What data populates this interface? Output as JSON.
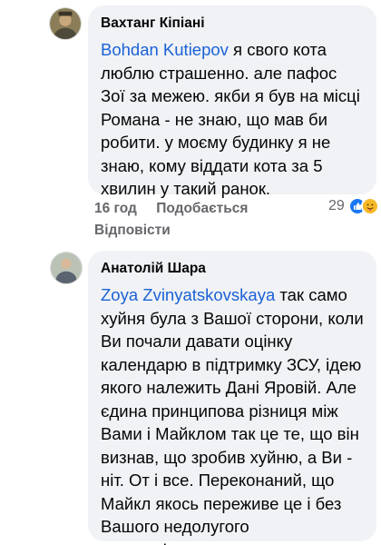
{
  "comments": [
    {
      "author": "Вахтанг Кіпіані",
      "mention": "Bohdan Kutiepov",
      "text": " я свого кота люблю страшенно. але пафос Зої за межею. якби я був на місці Романа - не знаю, що мав би робити. у моєму будинку я не знаю, кому віддати кота за 5 хвилин у такий ранок.",
      "time": "16 год",
      "like_label": "Подобається",
      "reply_label": "Відповісти",
      "reaction_count": "29",
      "reaction_icons": [
        "like-icon",
        "care-icon"
      ],
      "colors": {
        "like": "#1877f2",
        "care": "#f7b928"
      }
    },
    {
      "author": "Анатолій Шара",
      "mention": "Zoya Zvinyatskovskaya",
      "text": " так само хуйня була з Вашої сторони, коли Ви почали давати оцінку календарю в підтримку ЗСУ, ідею якого належить Дані Яровій. Але єдина принципова різниця між Вами і Майклом так це те, що він визнав, що зробив хуйню, а Ви - ніт. От і все. Переконаний, що Майкл якось переживе це і без Вашого недолугого просторікування."
    }
  ]
}
